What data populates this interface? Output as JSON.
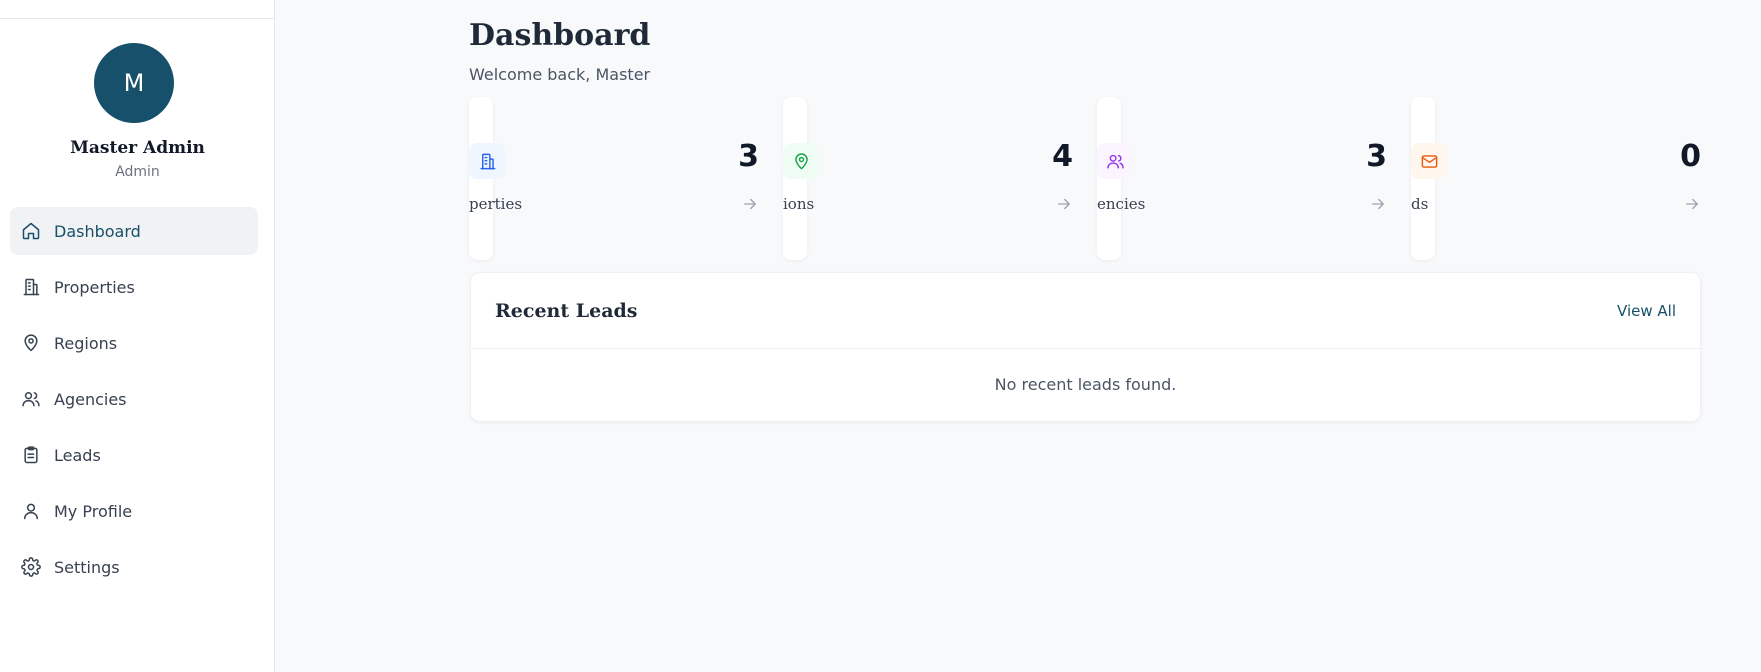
{
  "profile": {
    "initial": "M",
    "name": "Master Admin",
    "role": "Admin"
  },
  "sidebar": {
    "items": [
      {
        "label": "Dashboard",
        "icon": "home-icon",
        "active": true
      },
      {
        "label": "Properties",
        "icon": "building-icon"
      },
      {
        "label": "Regions",
        "icon": "map-pin-icon"
      },
      {
        "label": "Agencies",
        "icon": "users-icon"
      },
      {
        "label": "Leads",
        "icon": "clipboard-icon"
      },
      {
        "label": "My Profile",
        "icon": "user-icon"
      },
      {
        "label": "Settings",
        "icon": "gear-icon"
      }
    ]
  },
  "header": {
    "title": "Dashboard",
    "subtitle": "Welcome back, Master"
  },
  "stats": [
    {
      "label": "Properties",
      "visible_label": "perties",
      "value": "3",
      "icon": "building-icon",
      "color": "#2563eb",
      "bg": "#eff6ff"
    },
    {
      "label": "Regions",
      "visible_label": "ions",
      "value": "4",
      "icon": "map-pin-icon",
      "color": "#16a34a",
      "bg": "#f0fdf4"
    },
    {
      "label": "Agencies",
      "visible_label": "encies",
      "value": "3",
      "icon": "users-icon",
      "color": "#9333ea",
      "bg": "#faf5ff"
    },
    {
      "label": "Leads",
      "visible_label": "ds",
      "value": "0",
      "icon": "mail-icon",
      "color": "#ea580c",
      "bg": "#fff7ed"
    }
  ],
  "recent_leads": {
    "title": "Recent Leads",
    "view_all": "View All",
    "empty": "No recent leads found."
  },
  "colors": {
    "primary": "#17506a",
    "background": "#f8f9fb"
  }
}
